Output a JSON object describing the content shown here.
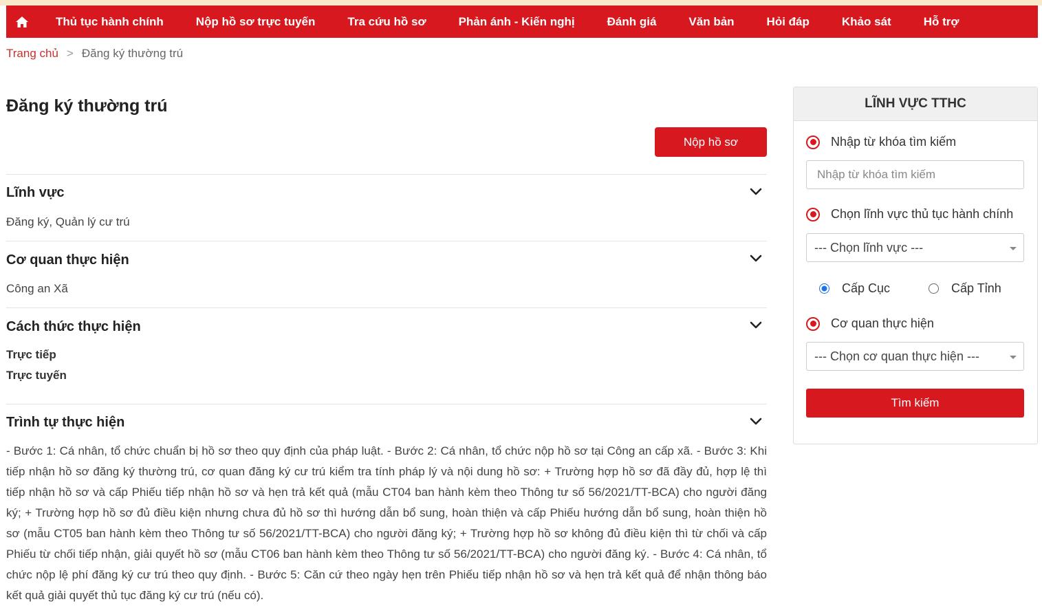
{
  "nav": {
    "items": [
      "Thủ tục hành chính",
      "Nộp hồ sơ trực tuyến",
      "Tra cứu hồ sơ",
      "Phản ánh - Kiến nghị",
      "Đánh giá",
      "Văn bản",
      "Hỏi đáp",
      "Khảo sát",
      "Hỗ trợ"
    ]
  },
  "breadcrumb": {
    "home": "Trang chủ",
    "separator": ">",
    "current": "Đăng ký thường trú"
  },
  "page": {
    "title": "Đăng ký thường trú",
    "submit_label": "Nộp hồ sơ"
  },
  "sections": {
    "field": {
      "title": "Lĩnh vực",
      "value": "Đăng ký, Quản lý cư trú"
    },
    "agency": {
      "title": "Cơ quan thực hiện",
      "value": "Công an Xã"
    },
    "method": {
      "title": "Cách thức thực hiện",
      "values": [
        "Trực tiếp",
        "Trực tuyến"
      ]
    },
    "procedure": {
      "title": "Trình tự thực hiện",
      "text": "- Bước 1: Cá nhân, tổ chức chuẩn bị hồ sơ theo quy định của pháp luật. - Bước 2: Cá nhân, tổ chức nộp hồ sơ tại Công an cấp xã. - Bước 3: Khi tiếp nhận hồ sơ đăng ký thường trú, cơ quan đăng ký cư trú kiểm tra tính pháp lý và nội dung hồ sơ: + Trường hợp hồ sơ đã đầy đủ, hợp lệ thì tiếp nhận hồ sơ và cấp Phiếu tiếp nhận hồ sơ và hẹn trả kết quả (mẫu CT04 ban hành kèm theo Thông tư số 56/2021/TT-BCA) cho người đăng ký; + Trường hợp hồ sơ đủ điều kiện nhưng chưa đủ hồ sơ thì hướng dẫn bổ sung, hoàn thiện và cấp Phiếu hướng dẫn bổ sung, hoàn thiện hồ sơ (mẫu CT05 ban hành kèm theo Thông tư số 56/2021/TT-BCA) cho người đăng ký; + Trường hợp hồ sơ không đủ điều kiện thì từ chối và cấp Phiếu từ chối tiếp nhận, giải quyết hồ sơ (mẫu CT06 ban hành kèm theo Thông tư số 56/2021/TT-BCA) cho người đăng ký. - Bước 4: Cá nhân, tổ chức nộp lệ phí đăng ký cư trú theo quy định. - Bước 5: Căn cứ theo ngày hẹn trên Phiếu tiếp nhận hồ sơ và hẹn trả kết quả để nhận thông báo kết quả giải quyết thủ tục đăng ký cư trú (nếu có)."
    }
  },
  "sidebar": {
    "title": "LĨNH VỰC TTHC",
    "keyword_label": "Nhập từ khóa tìm kiếm",
    "keyword_placeholder": "Nhập từ khóa tìm kiếm",
    "keyword_value": "",
    "field_label": "Chọn lĩnh vực thủ tục hành chính",
    "field_select": "--- Chọn lĩnh vực ---",
    "level_options": [
      "Cấp Cục",
      "Cấp Tỉnh"
    ],
    "agency_label": "Cơ quan thực hiện",
    "agency_select": "--- Chọn cơ quan thực hiện ---",
    "search_label": "Tìm kiếm"
  },
  "colors": {
    "primary_red": "#d7181f",
    "radio_blue": "#1a73e8"
  }
}
